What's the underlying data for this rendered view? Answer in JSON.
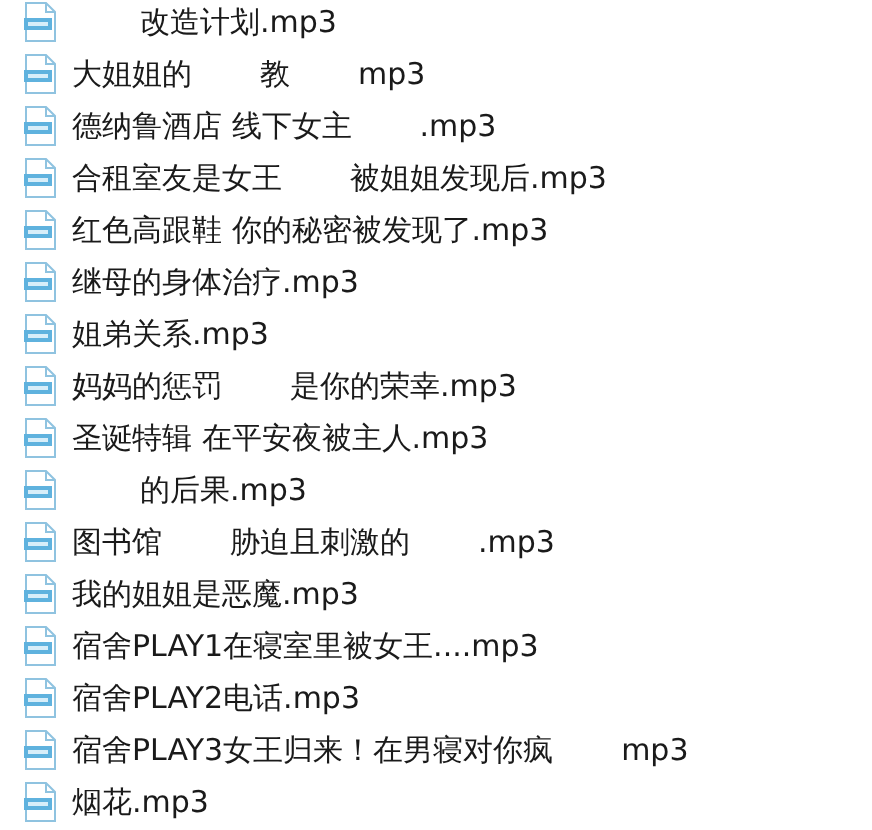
{
  "files": [
    {
      "hidden_start": true,
      "parts": [
        "改造计划.mp3"
      ]
    },
    {
      "hidden_start": false,
      "parts": [
        "大姐姐的",
        "教",
        "mp3"
      ]
    },
    {
      "hidden_start": false,
      "parts": [
        "德纳鲁酒店 线下女主",
        ".mp3"
      ]
    },
    {
      "hidden_start": false,
      "parts": [
        "合租室友是女王",
        "被姐姐发现后.mp3"
      ]
    },
    {
      "hidden_start": false,
      "parts": [
        "红色高跟鞋 你的秘密被发现了.mp3"
      ]
    },
    {
      "hidden_start": false,
      "parts": [
        "继母的身体治疗.mp3"
      ]
    },
    {
      "hidden_start": false,
      "parts": [
        "姐弟关系.mp3"
      ]
    },
    {
      "hidden_start": false,
      "parts": [
        "妈妈的惩罚",
        "是你的荣幸.mp3"
      ]
    },
    {
      "hidden_start": false,
      "parts": [
        "圣诞特辑 在平安夜被主人.mp3"
      ]
    },
    {
      "hidden_start": true,
      "parts": [
        "的后果.mp3"
      ]
    },
    {
      "hidden_start": false,
      "parts": [
        "图书馆",
        "胁迫且刺激的",
        ".mp3"
      ]
    },
    {
      "hidden_start": false,
      "parts": [
        "我的姐姐是恶魔.mp3"
      ]
    },
    {
      "hidden_start": false,
      "parts": [
        "宿舍PLAY1在寝室里被女王....mp3"
      ]
    },
    {
      "hidden_start": false,
      "parts": [
        "宿舍PLAY2电话.mp3"
      ]
    },
    {
      "hidden_start": false,
      "parts": [
        "宿舍PLAY3女王归来！在男寝对你疯",
        "mp3"
      ]
    },
    {
      "hidden_start": false,
      "parts": [
        "烟花.mp3"
      ]
    }
  ]
}
